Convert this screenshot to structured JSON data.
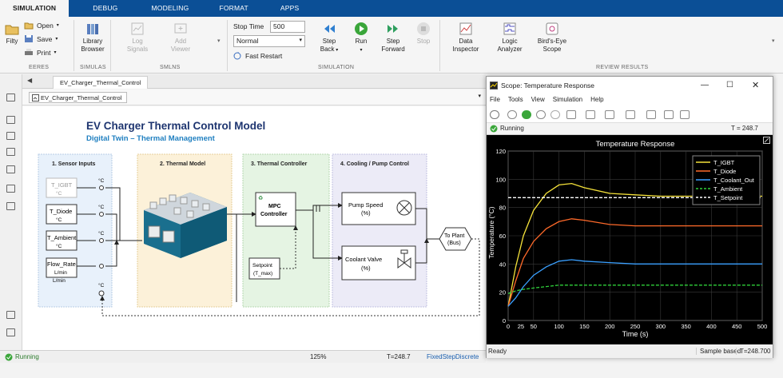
{
  "tabs": [
    "SIMULATION",
    "DEBUG",
    "MODELING",
    "FORMAT",
    "APPS"
  ],
  "ribbon": {
    "file_btn": "Filty",
    "open": "Open",
    "save": "Save",
    "print": "Print",
    "library_browser": [
      "Library",
      "Browser"
    ],
    "log_signals": [
      "Log",
      "Signals"
    ],
    "add_viewer": [
      "Add",
      "Viewer"
    ],
    "stop_time_label": "Stop Time",
    "stop_time_value": "500",
    "mode_value": "Normal",
    "fast_restart": "Fast Restart",
    "step_back": [
      "Step",
      "Back"
    ],
    "run": "Run",
    "step_forward": [
      "Step",
      "Forward"
    ],
    "stop": "Stop",
    "data_inspector": [
      "Data",
      "Inspector"
    ],
    "logic_analyzer": [
      "Logic",
      "Analyzer"
    ],
    "birds_eye": [
      "Bird's-Eye",
      "Scope"
    ],
    "group_labels": {
      "file": "EERES",
      "library": "SIMULAS",
      "prepare": "SMLNS",
      "simulation": "SIMULATION",
      "review": "REVIEW RESULTS"
    }
  },
  "doc_tab": "EV_Charger_Thermal_Control",
  "breadcrumb": "EV_Charger_Thermal_Control",
  "model": {
    "title": "EV Charger Thermal Control Model",
    "subtitle": "Digital Twin – Thermal Management",
    "sections": [
      "1. Sensor Inputs",
      "2. Thermal Model",
      "3. Thermal Controller",
      "4. Cooling / Pump Control"
    ],
    "sensors": [
      {
        "name": "T_IGBT",
        "unit": "°C"
      },
      {
        "name": "T_Diode",
        "unit": "°C"
      },
      {
        "name": "T_Ambient",
        "unit": "°C"
      },
      {
        "name": "Flow_Rate",
        "unit": "L/min",
        "unit2": "L/min"
      }
    ],
    "port_unit": "°C",
    "mpc": [
      "MPC",
      "Controller"
    ],
    "setpoint": [
      "Setpoint",
      "(T_max)"
    ],
    "pump": [
      "Pump Speed",
      "(%)"
    ],
    "valve": [
      "Coolant Valve",
      "(%)"
    ],
    "plant": [
      "To Plant",
      "(Bus)"
    ]
  },
  "status": {
    "state": "Running",
    "zoom": "125%",
    "time": "T=248.7",
    "solver": "FixedStepDiscrete"
  },
  "scope": {
    "title": "Scope: Temperature Response",
    "menu": [
      "File",
      "Tools",
      "View",
      "Simulation",
      "Help"
    ],
    "state": "Running",
    "time": "T = 248.7",
    "foot_left": "Ready",
    "foot_mode": "Sample based",
    "foot_time": "T=248.700"
  },
  "chart_data": {
    "type": "line",
    "title": "Temperature Response",
    "xlabel": "Time (s)",
    "ylabel": "Temperature (°C)",
    "xlim": [
      0,
      500
    ],
    "ylim": [
      0,
      120
    ],
    "xticks": [
      "0",
      "25",
      "50",
      "100",
      "150",
      "200",
      "250",
      "300",
      "350",
      "400",
      "450",
      "500"
    ],
    "yticks": [
      0,
      20,
      40,
      60,
      80,
      100,
      120
    ],
    "grid": true,
    "legend_position": "top-right",
    "series": [
      {
        "name": "T_IGBT",
        "color": "#f5e23a",
        "style": "solid",
        "x": [
          0,
          15,
          30,
          50,
          75,
          100,
          125,
          150,
          200,
          250,
          300,
          400,
          500
        ],
        "y": [
          10,
          38,
          60,
          78,
          90,
          96,
          97,
          94,
          90,
          89,
          88,
          88,
          88
        ]
      },
      {
        "name": "T_Diode",
        "color": "#ff6a2a",
        "style": "solid",
        "x": [
          0,
          15,
          30,
          50,
          75,
          100,
          125,
          150,
          200,
          250,
          300,
          400,
          500
        ],
        "y": [
          10,
          28,
          44,
          56,
          65,
          70,
          72,
          71,
          68,
          67,
          67,
          67,
          67
        ]
      },
      {
        "name": "T_Coolant_Out",
        "color": "#3aa0ff",
        "style": "solid",
        "x": [
          0,
          15,
          30,
          50,
          75,
          100,
          125,
          150,
          200,
          250,
          300,
          400,
          500
        ],
        "y": [
          10,
          16,
          24,
          32,
          38,
          42,
          43,
          42,
          41,
          40,
          40,
          40,
          40
        ]
      },
      {
        "name": "T_Ambient",
        "color": "#2fcf3a",
        "style": "dashed",
        "x": [
          0,
          15,
          30,
          50,
          75,
          100,
          150,
          200,
          300,
          400,
          500
        ],
        "y": [
          19,
          21,
          22,
          23,
          24,
          25,
          25,
          25,
          25,
          25,
          25
        ]
      },
      {
        "name": "T_Setpoint",
        "color": "#ffffff",
        "style": "dashed",
        "x": [
          0,
          500
        ],
        "y": [
          87,
          87
        ]
      }
    ]
  }
}
